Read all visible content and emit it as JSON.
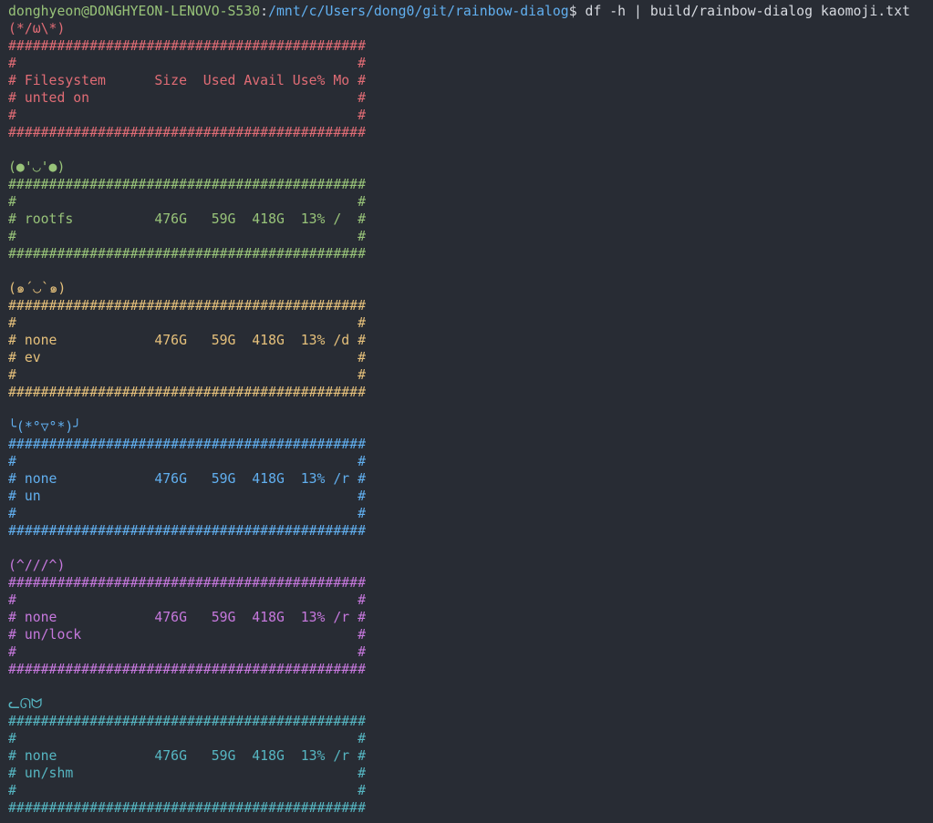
{
  "prompt": {
    "user_host": "donghyeon@DONGHYEON-LENOVO-S530",
    "colon": ":",
    "path": "/mnt/c/Users/dong0/git/rainbow-dialog",
    "dollar": "$",
    "command": " df -h | build/rainbow-dialog kaomoji.txt"
  },
  "colors": {
    "red": "#e06c75",
    "green": "#98c379",
    "yellow": "#e5c07b",
    "blue": "#61afef",
    "magenta": "#c678dd",
    "cyan": "#56b6c2",
    "background": "#282c34"
  },
  "blocks": [
    {
      "kaomoji": "(*/ω\\*)",
      "lines": [
        "############################################",
        "#                                          #",
        "# Filesystem      Size  Used Avail Use% Mo #",
        "# unted on                                 #",
        "#                                          #",
        "############################################"
      ]
    },
    {
      "kaomoji": "(●'◡'●)",
      "lines": [
        "############################################",
        "#                                          #",
        "# rootfs          476G   59G  418G  13% /  #",
        "#                                          #",
        "############################################"
      ]
    },
    {
      "kaomoji": "(๑´◡`๑)",
      "lines": [
        "############################################",
        "#                                          #",
        "# none            476G   59G  418G  13% /d #",
        "# ev                                       #",
        "#                                          #",
        "############################################"
      ]
    },
    {
      "kaomoji": "╰(*°▽°*)╯",
      "lines": [
        "############################################",
        "#                                          #",
        "# none            476G   59G  418G  13% /r #",
        "# un                                       #",
        "#                                          #",
        "############################################"
      ]
    },
    {
      "kaomoji": "(^///^)",
      "lines": [
        "############################################",
        "#                                          #",
        "# none            476G   59G  418G  13% /r #",
        "# un/lock                                  #",
        "#                                          #",
        "############################################"
      ]
    },
    {
      "kaomoji": "ᓚᘏᗢ",
      "lines": [
        "############################################",
        "#                                          #",
        "# none            476G   59G  418G  13% /r #",
        "# un/shm                                   #",
        "#                                          #",
        "############################################"
      ]
    }
  ]
}
